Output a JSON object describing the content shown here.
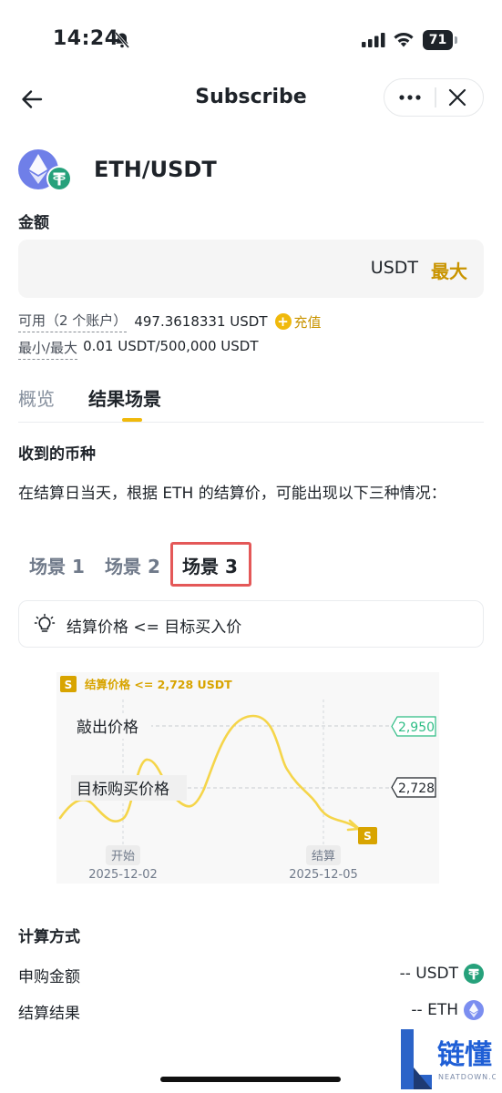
{
  "status": {
    "time": "14:24",
    "battery": "71"
  },
  "nav": {
    "title": "Subscribe"
  },
  "pair": {
    "name": "ETH/USDT"
  },
  "amount": {
    "label": "金额",
    "unit": "USDT",
    "max": "最大"
  },
  "available": {
    "label": "可用（2 个账户）",
    "value": "497.3618331 USDT",
    "deposit": "充值"
  },
  "minmax": {
    "label": "最小/最大",
    "value": "0.01 USDT/500,000 USDT"
  },
  "tabs": [
    {
      "label": "概览"
    },
    {
      "label": "结果场景"
    }
  ],
  "received": {
    "title": "收到的币种",
    "description": "在结算日当天，根据 ETH 的结算价，可能出现以下三种情况："
  },
  "scenarios": [
    {
      "label": "场景 1"
    },
    {
      "label": "场景 2"
    },
    {
      "label": "场景 3"
    }
  ],
  "condition": {
    "text": "结算价格 <= 目标买入价",
    "icon": "lightbulb-icon"
  },
  "chart": {
    "badge": "S",
    "legend": "结算价格 <= 2,728 USDT",
    "knockout_label": "敲出价格",
    "knockout_value": "2,950",
    "target_label": "目标购买价格",
    "target_value": "2,728",
    "start_label": "开始",
    "start_date": "2025-12-02",
    "settle_label": "结算",
    "settle_date": "2025-12-05",
    "colors": {
      "line": "#f5d54a",
      "knockout": "#2ebd85",
      "badge": "#d8a400"
    }
  },
  "calc": {
    "title": "计算方式",
    "rows": [
      {
        "label": "申购金额",
        "value": "-- USDT",
        "icon": "usdt-icon"
      },
      {
        "label": "结算结果",
        "value": "-- ETH",
        "icon": "eth-icon"
      }
    ]
  },
  "watermark": {
    "brand": "链懂",
    "site": "NEATDOWN.COM"
  }
}
